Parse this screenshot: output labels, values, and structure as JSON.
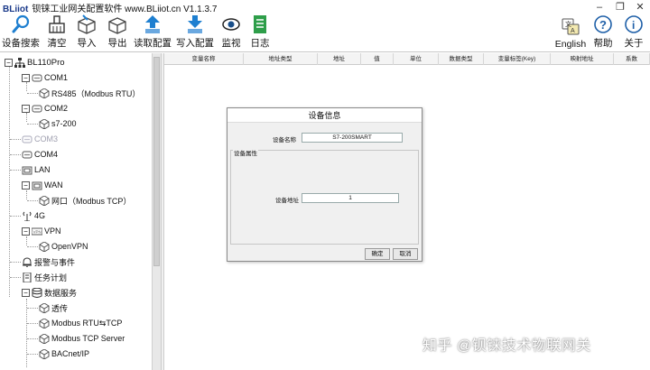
{
  "window": {
    "brand": "BLiiot",
    "title": "钡铼工业网关配置软件 www.BLiiot.cn V1.1.3.7",
    "minimize": "–",
    "restore": "❐",
    "close": "✕"
  },
  "toolbar": {
    "left": [
      {
        "label": "设备搜索",
        "icon": "search-icon"
      },
      {
        "label": "清空",
        "icon": "clear-icon"
      },
      {
        "label": "导入",
        "icon": "import-icon"
      },
      {
        "label": "导出",
        "icon": "export-icon"
      },
      {
        "label": "读取配置",
        "icon": "read-config-icon"
      },
      {
        "label": "写入配置",
        "icon": "write-config-icon"
      },
      {
        "label": "监视",
        "icon": "eye-icon"
      },
      {
        "label": "日志",
        "icon": "log-icon"
      }
    ],
    "right": [
      {
        "label": "English",
        "icon": "language-icon"
      },
      {
        "label": "帮助",
        "icon": "help-icon"
      },
      {
        "label": "关于",
        "icon": "info-icon"
      }
    ]
  },
  "tree": {
    "root": "BL110Pro",
    "com1": "COM1",
    "rs485": "RS485（Modbus RTU）",
    "com2": "COM2",
    "s7": "s7-200",
    "com3": "COM3",
    "com4": "COM4",
    "lan": "LAN",
    "wan": "WAN",
    "wangkou": "网口（Modbus TCP）",
    "g4": "4G",
    "vpn": "VPN",
    "openvpn": "OpenVPN",
    "alarm": "报警与事件",
    "task": "任务计划",
    "data": "数据服务",
    "passthrough": "透传",
    "rtu_tcp": "Modbus RTU⇆TCP",
    "tcp_server": "Modbus TCP Server",
    "bacnet": "BACnet/IP"
  },
  "grid": {
    "columns": [
      "变量名称",
      "地址类型",
      "地址",
      "值",
      "单位",
      "数据类型",
      "变量标签(Key)",
      "映射地址",
      "系数"
    ]
  },
  "dialog": {
    "title": "设备信息",
    "name_label": "设备名称",
    "name_value": "S7-200SMART",
    "group_label": "设备属性",
    "addr_label": "设备地址",
    "addr_value": "1",
    "ok": "确定",
    "cancel": "取消"
  },
  "watermark": "知乎 @钡铼技术物联网关",
  "colors": {
    "accent": "#1e7fd0",
    "disabled": "#a0a0b0"
  }
}
